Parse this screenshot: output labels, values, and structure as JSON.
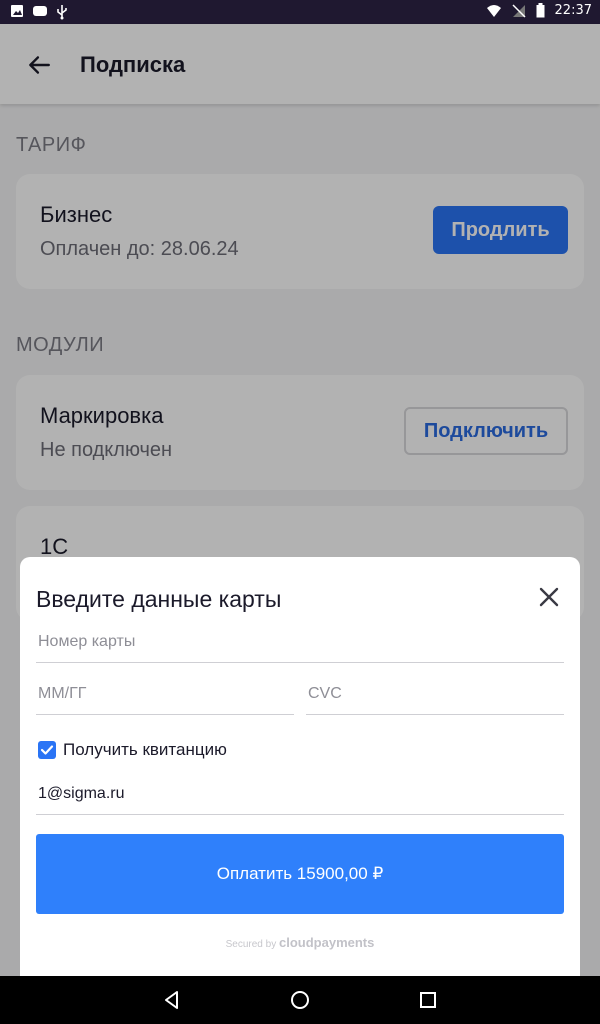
{
  "status_bar": {
    "time": "22:37"
  },
  "app_bar": {
    "title": "Подписка"
  },
  "tariff": {
    "section_label": "ТАРИФ",
    "plan_name": "Бизнес",
    "paid_until": "Оплачен до: 28.06.24",
    "extend_label": "Продлить"
  },
  "modules": {
    "section_label": "МОДУЛИ",
    "items": [
      {
        "name": "Маркировка",
        "status": "Не подключен",
        "action_label": "Подключить"
      },
      {
        "name": "1С"
      }
    ]
  },
  "payment_sheet": {
    "title": "Введите данные карты",
    "card_number_placeholder": "Номер карты",
    "expiry_placeholder": "ММ/ГГ",
    "cvc_placeholder": "CVC",
    "receipt_label": "Получить квитанцию",
    "receipt_checked": true,
    "email_value": "1@sigma.ru",
    "pay_label": "Оплатить 15900,00 ₽",
    "secured_prefix": "Secured by",
    "secured_brand": "cloudpayments"
  },
  "colors": {
    "accent": "#2a74f5",
    "pay_button": "#2f80fb",
    "status_bar": "#1f1830"
  }
}
